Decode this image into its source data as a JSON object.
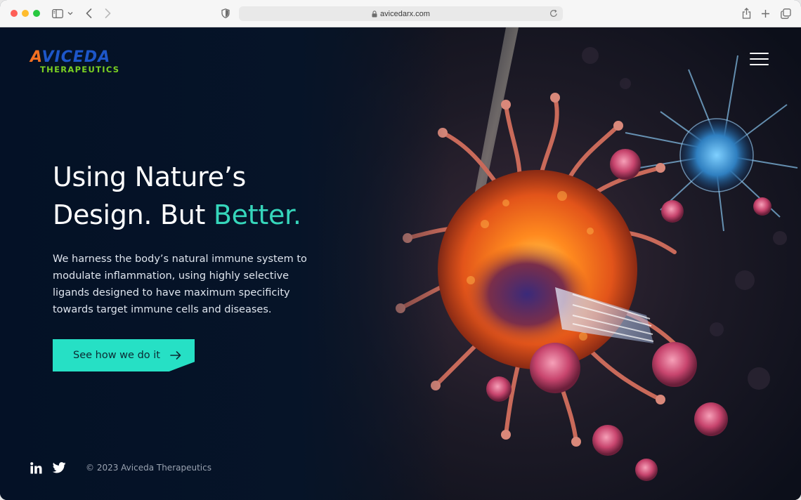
{
  "browser": {
    "url": "avicedarx.com"
  },
  "logo": {
    "brand_mark": "A",
    "brand_rest": "VICEDA",
    "tagline": "THERAPEUTICS"
  },
  "hero": {
    "headline_line1": "Using Nature’s",
    "headline_line2_start": "Design. But ",
    "headline_accent": "Better.",
    "lead": "We harness the body’s natural immune system to modulate inflammation, using highly selective ligands designed to have maximum specificity towards target immune cells and diseases.",
    "cta_label": "See how we do it"
  },
  "footer": {
    "copyright": "© 2023 Aviceda Therapeutics"
  },
  "icons": [
    "sidebar-icon",
    "chevron-down-icon",
    "back-arrow-icon",
    "forward-arrow-icon",
    "shield-icon",
    "lock-icon",
    "reload-icon",
    "share-icon",
    "plus-icon",
    "tabs-icon",
    "hamburger-menu-icon",
    "arrow-right-icon",
    "linkedin-icon",
    "twitter-icon"
  ],
  "colors": {
    "background": "#061427",
    "accent": "#36d6bb",
    "cta": "#26e0c5",
    "logo_blue": "#1d56c9",
    "logo_orange": "#f37021",
    "logo_green": "#7ad022"
  }
}
